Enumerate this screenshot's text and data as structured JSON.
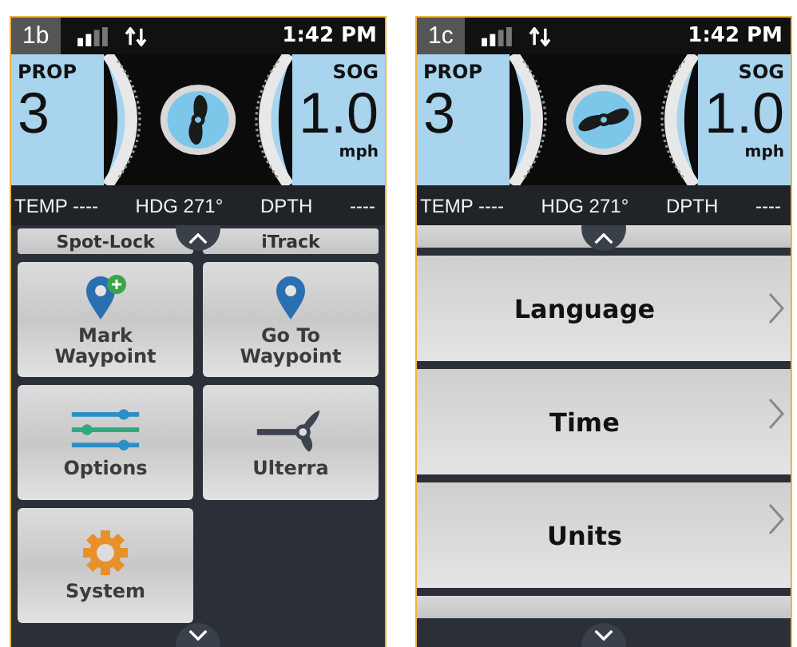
{
  "screens": [
    {
      "badge": "1b",
      "time": "1:42 PM",
      "prop": {
        "label": "PROP",
        "value": "3"
      },
      "speed": {
        "label": "SOG",
        "value": "1.0",
        "unit": "mph"
      },
      "info": [
        "TEMP ----",
        "HDG 271°",
        "DPTH",
        "----"
      ],
      "menu": {
        "kind": "tiles",
        "partial_above": [
          "Spot-Lock",
          "iTrack"
        ],
        "items": [
          {
            "kind": "pin-plus",
            "label": "Mark Waypoint"
          },
          {
            "kind": "pin",
            "label": "Go To Waypoint"
          },
          {
            "kind": "sliders",
            "label": "Options"
          },
          {
            "kind": "propeller",
            "label": "Ulterra"
          },
          {
            "kind": "gear",
            "label": "System"
          }
        ]
      }
    },
    {
      "badge": "1c",
      "time": "1:42 PM",
      "prop": {
        "label": "PROP",
        "value": "3"
      },
      "speed": {
        "label": "SOG",
        "value": "1.0",
        "unit": "mph"
      },
      "info": [
        "TEMP ----",
        "HDG 271°",
        "DPTH",
        "----"
      ],
      "menu": {
        "kind": "list",
        "items": [
          {
            "label": "Language"
          },
          {
            "label": "Time"
          },
          {
            "label": "Units"
          }
        ]
      }
    }
  ]
}
